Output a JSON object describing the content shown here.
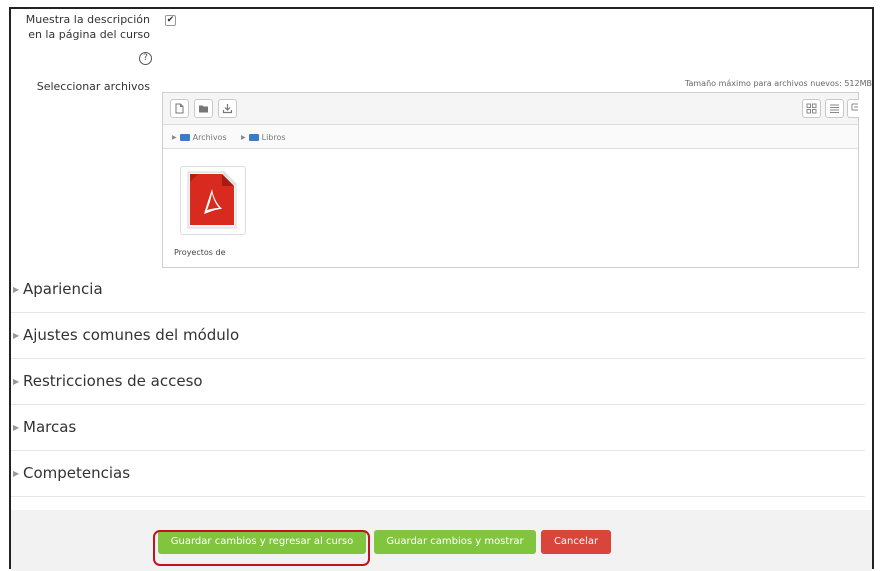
{
  "description_option": {
    "label": "Muestra la descripción en la página del curso",
    "checked": true,
    "help_icon": "question-circle-icon"
  },
  "files": {
    "label": "Seleccionar archivos",
    "max_size": "Tamaño máximo para archivos nuevos: 512MB",
    "toolbar": {
      "left_icons": [
        "add-file-icon",
        "create-folder-icon",
        "download-icon"
      ],
      "right_icons": [
        "view-icons-icon",
        "view-list-icon",
        "view-tree-icon"
      ]
    },
    "breadcrumb": [
      "Archivos",
      "Libros"
    ],
    "items": [
      {
        "name": "Proyectos de",
        "icon": "pdf-file-icon"
      }
    ]
  },
  "sections": [
    {
      "title": "Apariencia"
    },
    {
      "title": "Ajustes comunes del módulo"
    },
    {
      "title": "Restricciones de acceso"
    },
    {
      "title": "Marcas"
    },
    {
      "title": "Competencias"
    }
  ],
  "buttons": {
    "save_return": "Guardar cambios y regresar al curso",
    "save_display": "Guardar cambios y mostrar",
    "cancel": "Cancelar"
  },
  "colors": {
    "save_button": "#81c53e",
    "cancel_button": "#d9443b",
    "highlight": "#c0141c"
  }
}
